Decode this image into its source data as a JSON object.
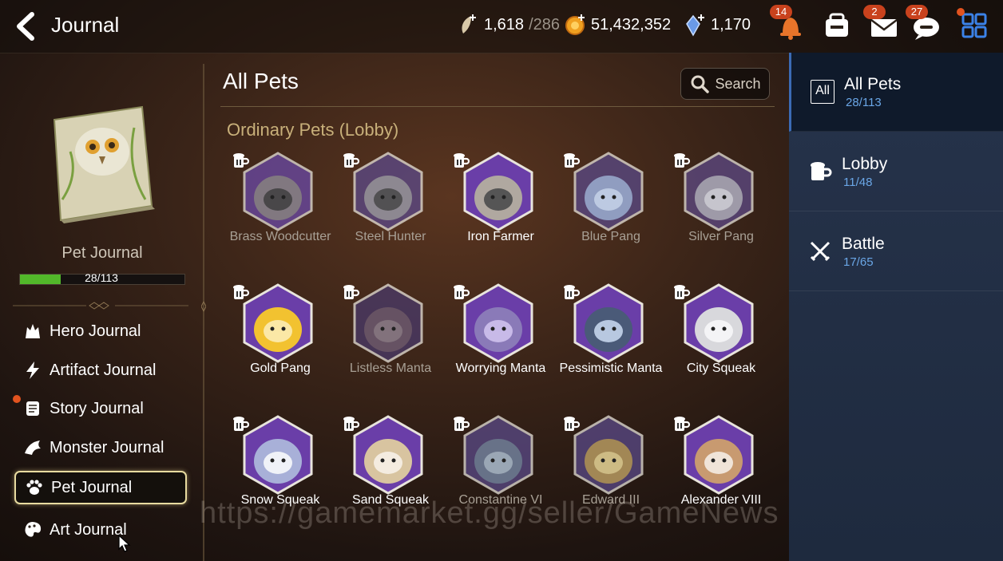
{
  "header": {
    "title": "Journal",
    "stamina_value": "1,618",
    "stamina_max": "/286",
    "gold": "51,432,352",
    "crystals": "1,170",
    "notifications_badge": "14",
    "mail_badge": "2",
    "chat_badge": "27",
    "icons": [
      "back-arrow-icon",
      "leaf-stamina-icon",
      "gold-coin-icon",
      "crystal-icon",
      "bell-icon",
      "inventory-icon",
      "mail-icon",
      "chat-icon",
      "menu-grid-icon"
    ]
  },
  "sidebar": {
    "book_title": "Pet Journal",
    "progress_text": "28/113",
    "progress_fraction": 0.248,
    "items": [
      {
        "label": "Hero Journal",
        "icon": "hero-icon"
      },
      {
        "label": "Artifact Journal",
        "icon": "lightning-icon"
      },
      {
        "label": "Story Journal",
        "icon": "scroll-icon"
      },
      {
        "label": "Monster Journal",
        "icon": "dragon-icon"
      },
      {
        "label": "Pet Journal",
        "icon": "paw-icon"
      },
      {
        "label": "Art Journal",
        "icon": "palette-icon"
      }
    ]
  },
  "main": {
    "title": "All Pets",
    "search_label": "Search",
    "section_title": "Ordinary Pets (Lobby)",
    "pets": [
      {
        "name": "Brass Woodcutter",
        "bg": "#6b4aa8",
        "body": "#8a8680",
        "face": "#3b3b3b",
        "dim": true
      },
      {
        "name": "Steel Hunter",
        "bg": "#5c4a8a",
        "body": "#9a9a9a",
        "face": "#444",
        "dim": true
      },
      {
        "name": "Iron Farmer",
        "bg": "#6a3ea8",
        "body": "#b0a8a0",
        "face": "#555",
        "dim": false
      },
      {
        "name": "Blue Pang",
        "bg": "#5a4a88",
        "body": "#9fb4d6",
        "face": "#c8d6ea",
        "dim": true
      },
      {
        "name": "Silver Pang",
        "bg": "#5e4a86",
        "body": "#b0b0b8",
        "face": "#d0d0d6",
        "dim": true
      },
      {
        "name": "Gold Pang",
        "bg": "#6a3ea8",
        "body": "#f2c230",
        "face": "#fbe8a6",
        "dim": false
      },
      {
        "name": "Listless Manta",
        "bg": "#4a3a6a",
        "body": "#6e5a66",
        "face": "#8a7a82",
        "dim": true
      },
      {
        "name": "Worrying Manta",
        "bg": "#6a3ea8",
        "body": "#8a7ab8",
        "face": "#c8bae8",
        "dim": false
      },
      {
        "name": "Pessimistic Manta",
        "bg": "#6a3ea8",
        "body": "#4a5a78",
        "face": "#b8c8e0",
        "dim": false
      },
      {
        "name": "City Squeak",
        "bg": "#6a3ea8",
        "body": "#d8d8dc",
        "face": "#f4f4f6",
        "dim": false
      },
      {
        "name": "Snow Squeak",
        "bg": "#6a3ea8",
        "body": "#a8b0d8",
        "face": "#f0f2f8",
        "dim": false
      },
      {
        "name": "Sand Squeak",
        "bg": "#6a3ea8",
        "body": "#d8c4a0",
        "face": "#f4ece0",
        "dim": false
      },
      {
        "name": "Constantine VI",
        "bg": "#5a4a88",
        "body": "#6e8090",
        "face": "#a8b4c0",
        "dim": true
      },
      {
        "name": "Edward III",
        "bg": "#5a4a88",
        "body": "#b89a50",
        "face": "#d8c890",
        "dim": true
      },
      {
        "name": "Alexander VIII",
        "bg": "#6a3ea8",
        "body": "#c89a70",
        "face": "#f0e4d8",
        "dim": false
      }
    ]
  },
  "filters": [
    {
      "label": "All Pets",
      "count": "28/113",
      "icon": "all-icon",
      "icon_text": "All",
      "active": true
    },
    {
      "label": "Lobby",
      "count": "11/48",
      "icon": "lobby-mug-icon",
      "active": false
    },
    {
      "label": "Battle",
      "count": "17/65",
      "icon": "crossed-swords-icon",
      "active": false
    }
  ],
  "watermark": "https://gamemarket.gg/seller/GameNews",
  "colors": {
    "accent_blue": "#6aa6e6",
    "progress_green": "#52b82a",
    "badge_red": "#c9421d"
  }
}
